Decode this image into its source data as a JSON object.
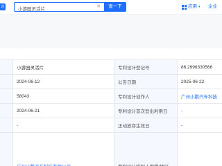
{
  "header": {
    "logo_text": "企业",
    "search_value": "小游园灵活片",
    "search_button": "查一下",
    "app_label": "应用",
    "enterprise_label": "企业"
  },
  "table": {
    "rows": [
      {
        "v1": "小游园灵活片",
        "k2": "专利设计登记号",
        "v2": "86.2996330566"
      },
      {
        "v1": "2024-06-12",
        "k2": "公告日期",
        "v2": "2025-06-22"
      },
      {
        "v1": "58043",
        "k2": "专利设计创作人",
        "v2": "广州小鹏汽车科技"
      },
      {
        "v1": "2024-06-21",
        "k2": "专利设计首次登出利用日",
        "v2": "-"
      },
      {
        "v1": "-",
        "k2": "正动放存生效日",
        "v2": "-"
      },
      {
        "v1": "广州小鹏汽车科技有限公司",
        "k2": "专利设计权利人国籍/地区",
        "v2": "-"
      }
    ]
  }
}
